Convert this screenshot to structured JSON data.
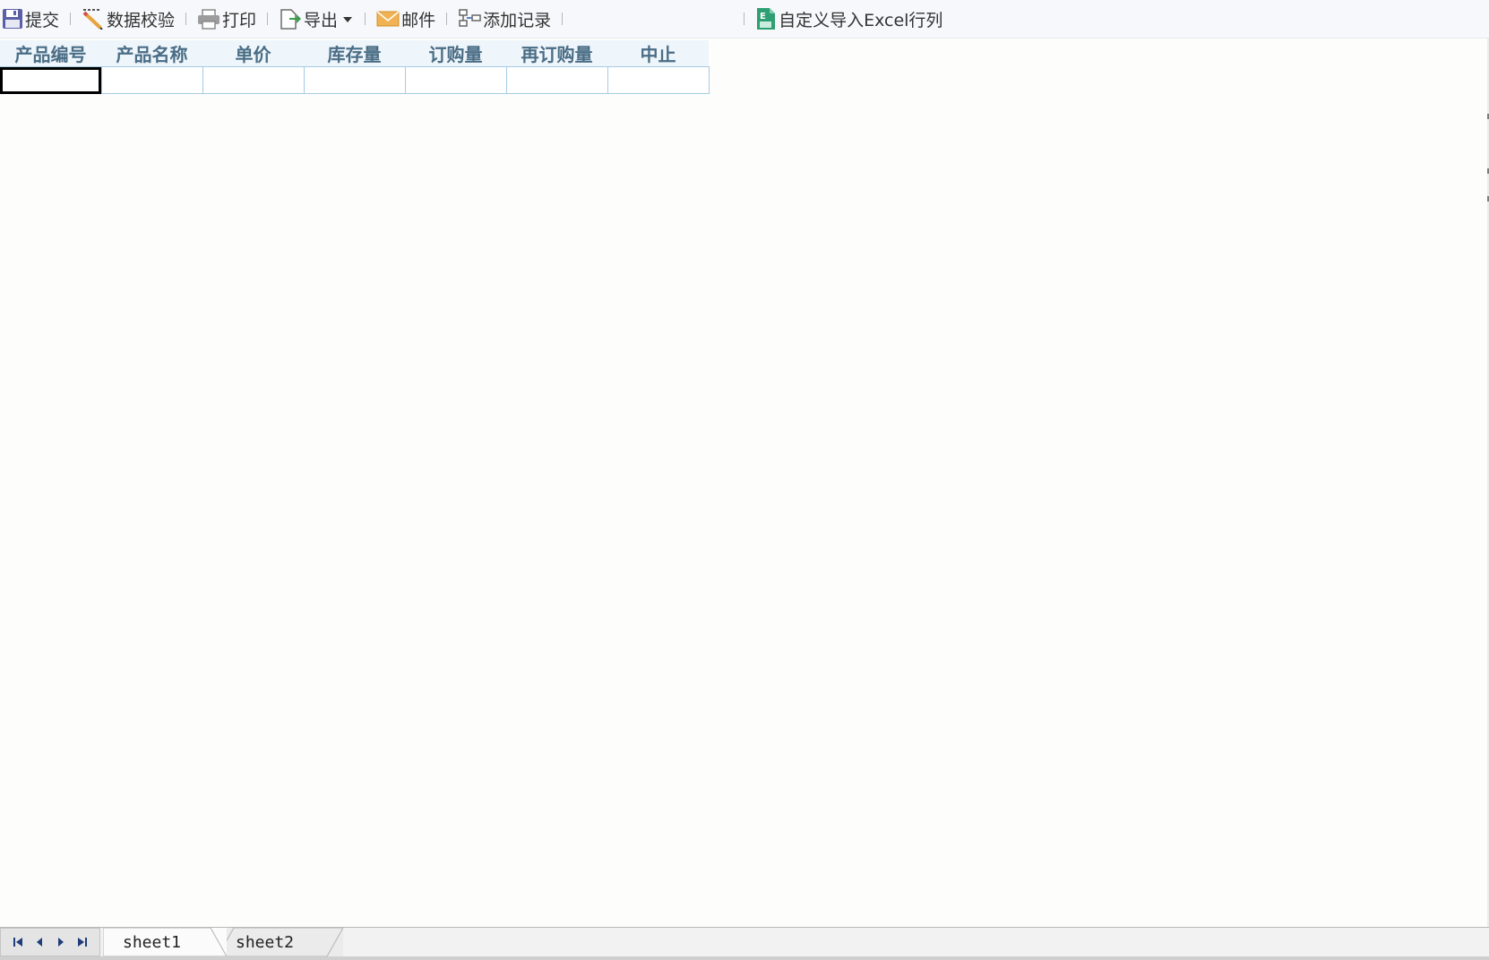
{
  "toolbar": {
    "submit": "提交",
    "validate": "数据校验",
    "print": "打印",
    "export": "导出",
    "mail": "邮件",
    "add_record": "添加记录",
    "import_excel": "自定义导入Excel行列",
    "icons": {
      "submit": "floppy-disk-icon",
      "validate": "pencil-check-icon",
      "print": "printer-icon",
      "export": "export-icon",
      "mail": "envelope-icon",
      "add_record": "add-record-icon",
      "import_excel": "excel-icon"
    }
  },
  "table": {
    "columns": [
      "产品编号",
      "产品名称",
      "单价",
      "库存量",
      "订购量",
      "再订购量",
      "中止"
    ],
    "rows": [
      [
        "",
        "",
        "",
        "",
        "",
        "",
        ""
      ]
    ]
  },
  "sheets": {
    "tabs": [
      "sheet1",
      "sheet2"
    ],
    "active": "sheet1"
  },
  "colors": {
    "header_text": "#4a6d85",
    "grid_line": "#a7cbe3",
    "header_bg": "#eef5fb"
  }
}
